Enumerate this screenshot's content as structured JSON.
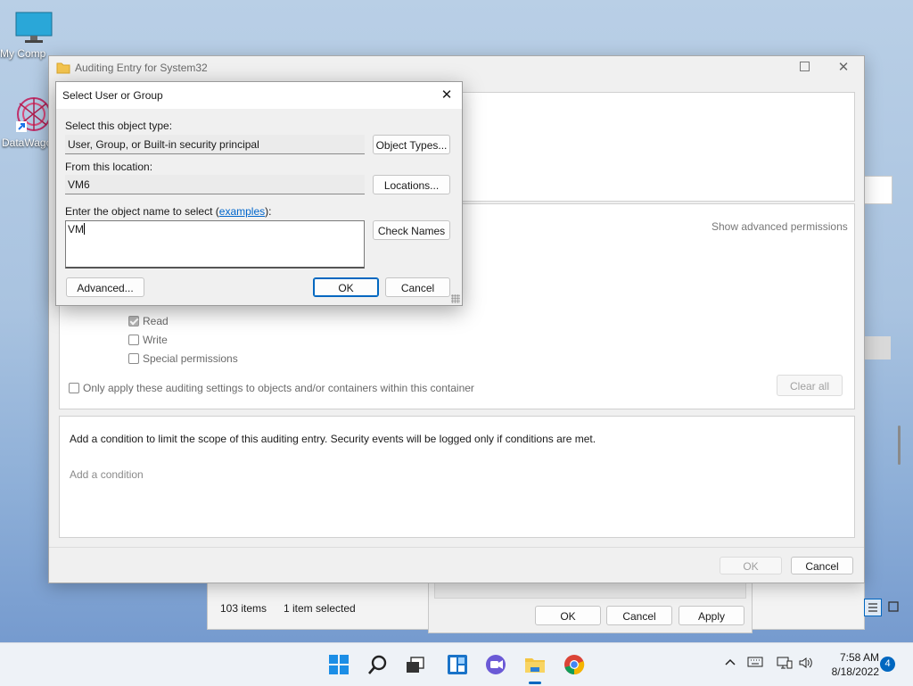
{
  "desktop": {
    "icons": [
      {
        "label": "My Comp"
      },
      {
        "label": "DataWago"
      }
    ]
  },
  "explorer": {
    "status_items": "103 items",
    "status_selected": "1 item selected"
  },
  "properties_dialog": {
    "ok": "OK",
    "cancel": "Cancel",
    "apply": "Apply"
  },
  "audit_window": {
    "title": "Auditing Entry for System32",
    "show_advanced": "Show advanced permissions",
    "permissions": [
      {
        "label": "Read",
        "checked": true
      },
      {
        "label": "Write",
        "checked": false
      },
      {
        "label": "Special permissions",
        "checked": false
      }
    ],
    "only_apply": "Only apply these auditing settings to objects and/or containers within this container",
    "clear_all": "Clear all",
    "condition_text": "Add a condition to limit the scope of this auditing entry. Security events will be logged only if conditions are met.",
    "add_condition": "Add a condition",
    "ok": "OK",
    "cancel": "Cancel"
  },
  "select_dialog": {
    "title": "Select User or Group",
    "object_type_label": "Select this object type:",
    "object_type_value": "User, Group, or Built-in security principal",
    "object_types_button": "Object Types...",
    "location_label": "From this location:",
    "location_value": "VM6",
    "locations_button": "Locations...",
    "enter_label_pre": "Enter the object name to select (",
    "enter_label_link": "examples",
    "enter_label_post": "):",
    "name_value": "VM",
    "check_names_button": "Check Names",
    "advanced_button": "Advanced...",
    "ok_button": "OK",
    "cancel_button": "Cancel"
  },
  "taskbar": {
    "time": "7:58 AM",
    "date": "8/18/2022",
    "notification_count": "4"
  }
}
